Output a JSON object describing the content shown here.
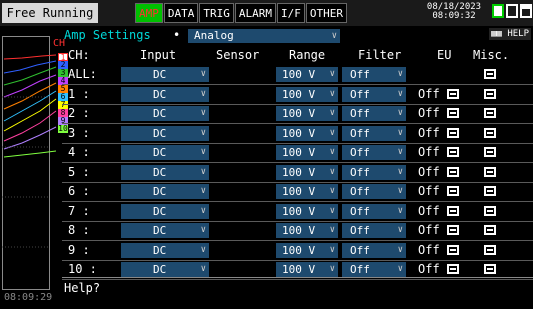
{
  "topbar": {
    "mode": "Free Running",
    "tabs": [
      "AMP",
      "DATA",
      "TRIG",
      "ALARM",
      "I/F",
      "OTHER"
    ],
    "active_tab": "AMP",
    "date": "08/18/2023",
    "time": "08:09:32"
  },
  "left": {
    "ch_label": "CH",
    "channels": [
      "1",
      "2",
      "3",
      "4",
      "5",
      "6",
      "7",
      "8",
      "9",
      "10"
    ],
    "channel_colors": [
      "#ff3030",
      "#3060ff",
      "#30c030",
      "#c040ff",
      "#ff8000",
      "#30c0ff",
      "#ffff00",
      "#ff40a0",
      "#b080ff",
      "#80ff40"
    ],
    "time": "08:09:29"
  },
  "settings": {
    "title": "Amp Settings",
    "dot": "•",
    "mode": "Analog",
    "help": "HELP"
  },
  "headers": {
    "ch": "CH:",
    "input": "Input",
    "sensor": "Sensor",
    "range": "Range",
    "filter": "Filter",
    "eu": "EU",
    "misc": "Misc."
  },
  "rows": [
    {
      "label": "ALL:",
      "input": "DC",
      "range": "100 V",
      "filter": "Off",
      "eu": ""
    },
    {
      "label": "1 :",
      "input": "DC",
      "range": "100 V",
      "filter": "Off",
      "eu": "Off"
    },
    {
      "label": "2 :",
      "input": "DC",
      "range": "100 V",
      "filter": "Off",
      "eu": "Off"
    },
    {
      "label": "3 :",
      "input": "DC",
      "range": "100 V",
      "filter": "Off",
      "eu": "Off"
    },
    {
      "label": "4 :",
      "input": "DC",
      "range": "100 V",
      "filter": "Off",
      "eu": "Off"
    },
    {
      "label": "5 :",
      "input": "DC",
      "range": "100 V",
      "filter": "Off",
      "eu": "Off"
    },
    {
      "label": "6 :",
      "input": "DC",
      "range": "100 V",
      "filter": "Off",
      "eu": "Off"
    },
    {
      "label": "7 :",
      "input": "DC",
      "range": "100 V",
      "filter": "Off",
      "eu": "Off"
    },
    {
      "label": "8 :",
      "input": "DC",
      "range": "100 V",
      "filter": "Off",
      "eu": "Off"
    },
    {
      "label": "9 :",
      "input": "DC",
      "range": "100 V",
      "filter": "Off",
      "eu": "Off"
    },
    {
      "label": "10 :",
      "input": "DC",
      "range": "100 V",
      "filter": "Off",
      "eu": "Off"
    }
  ],
  "help": {
    "text": "Help?"
  }
}
